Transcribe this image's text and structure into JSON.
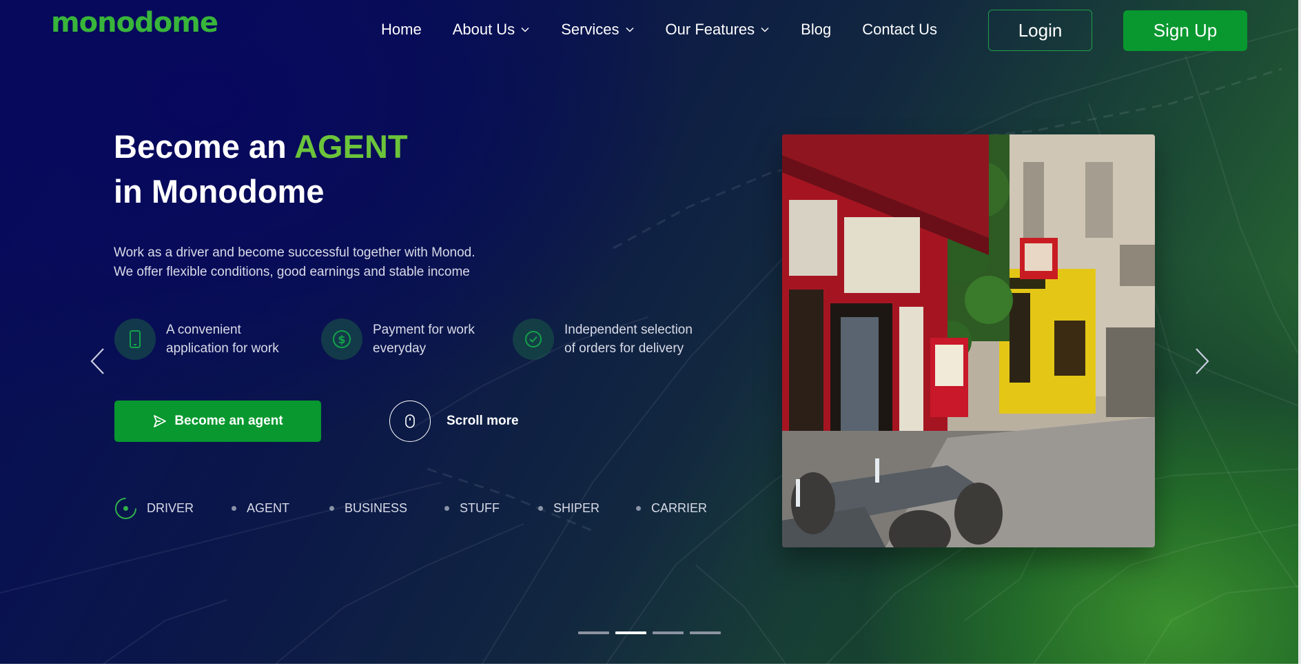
{
  "header": {
    "logo": "monodome",
    "nav": [
      {
        "label": "Home",
        "dropdown": false
      },
      {
        "label": "About Us",
        "dropdown": true
      },
      {
        "label": "Services",
        "dropdown": true
      },
      {
        "label": "Our Features",
        "dropdown": true
      },
      {
        "label": "Blog",
        "dropdown": false
      },
      {
        "label": "Contact Us",
        "dropdown": false
      }
    ],
    "login_label": "Login",
    "signup_label": "Sign Up"
  },
  "hero": {
    "title_prefix": "Become an ",
    "title_accent": "AGENT",
    "title_line2": "in Monodome",
    "subtitle_line1": "Work as a driver and become successful together with Monod.",
    "subtitle_line2": "We offer flexible conditions, good earnings and stable income",
    "features": [
      {
        "icon": "phone-icon",
        "line1": "A convenient",
        "line2": "application for work"
      },
      {
        "icon": "dollar-icon",
        "line1": "Payment for work",
        "line2": "everyday"
      },
      {
        "icon": "check-circle-icon",
        "line1": "Independent selection",
        "line2": "of orders for delivery"
      }
    ],
    "cta_label": "Become an agent",
    "scroll_label": "Scroll more",
    "roles": [
      "DRIVER",
      "AGENT",
      "BUSINESS",
      "STUFF",
      "SHIPER",
      "CARRIER"
    ],
    "active_role": "DRIVER"
  },
  "slider": {
    "slide_count": 4,
    "active_slide": 2
  },
  "colors": {
    "accent_green": "#6cc43b",
    "button_green": "#08982f",
    "logo_green": "#38b53a",
    "bg_navy": "#060a5a"
  }
}
